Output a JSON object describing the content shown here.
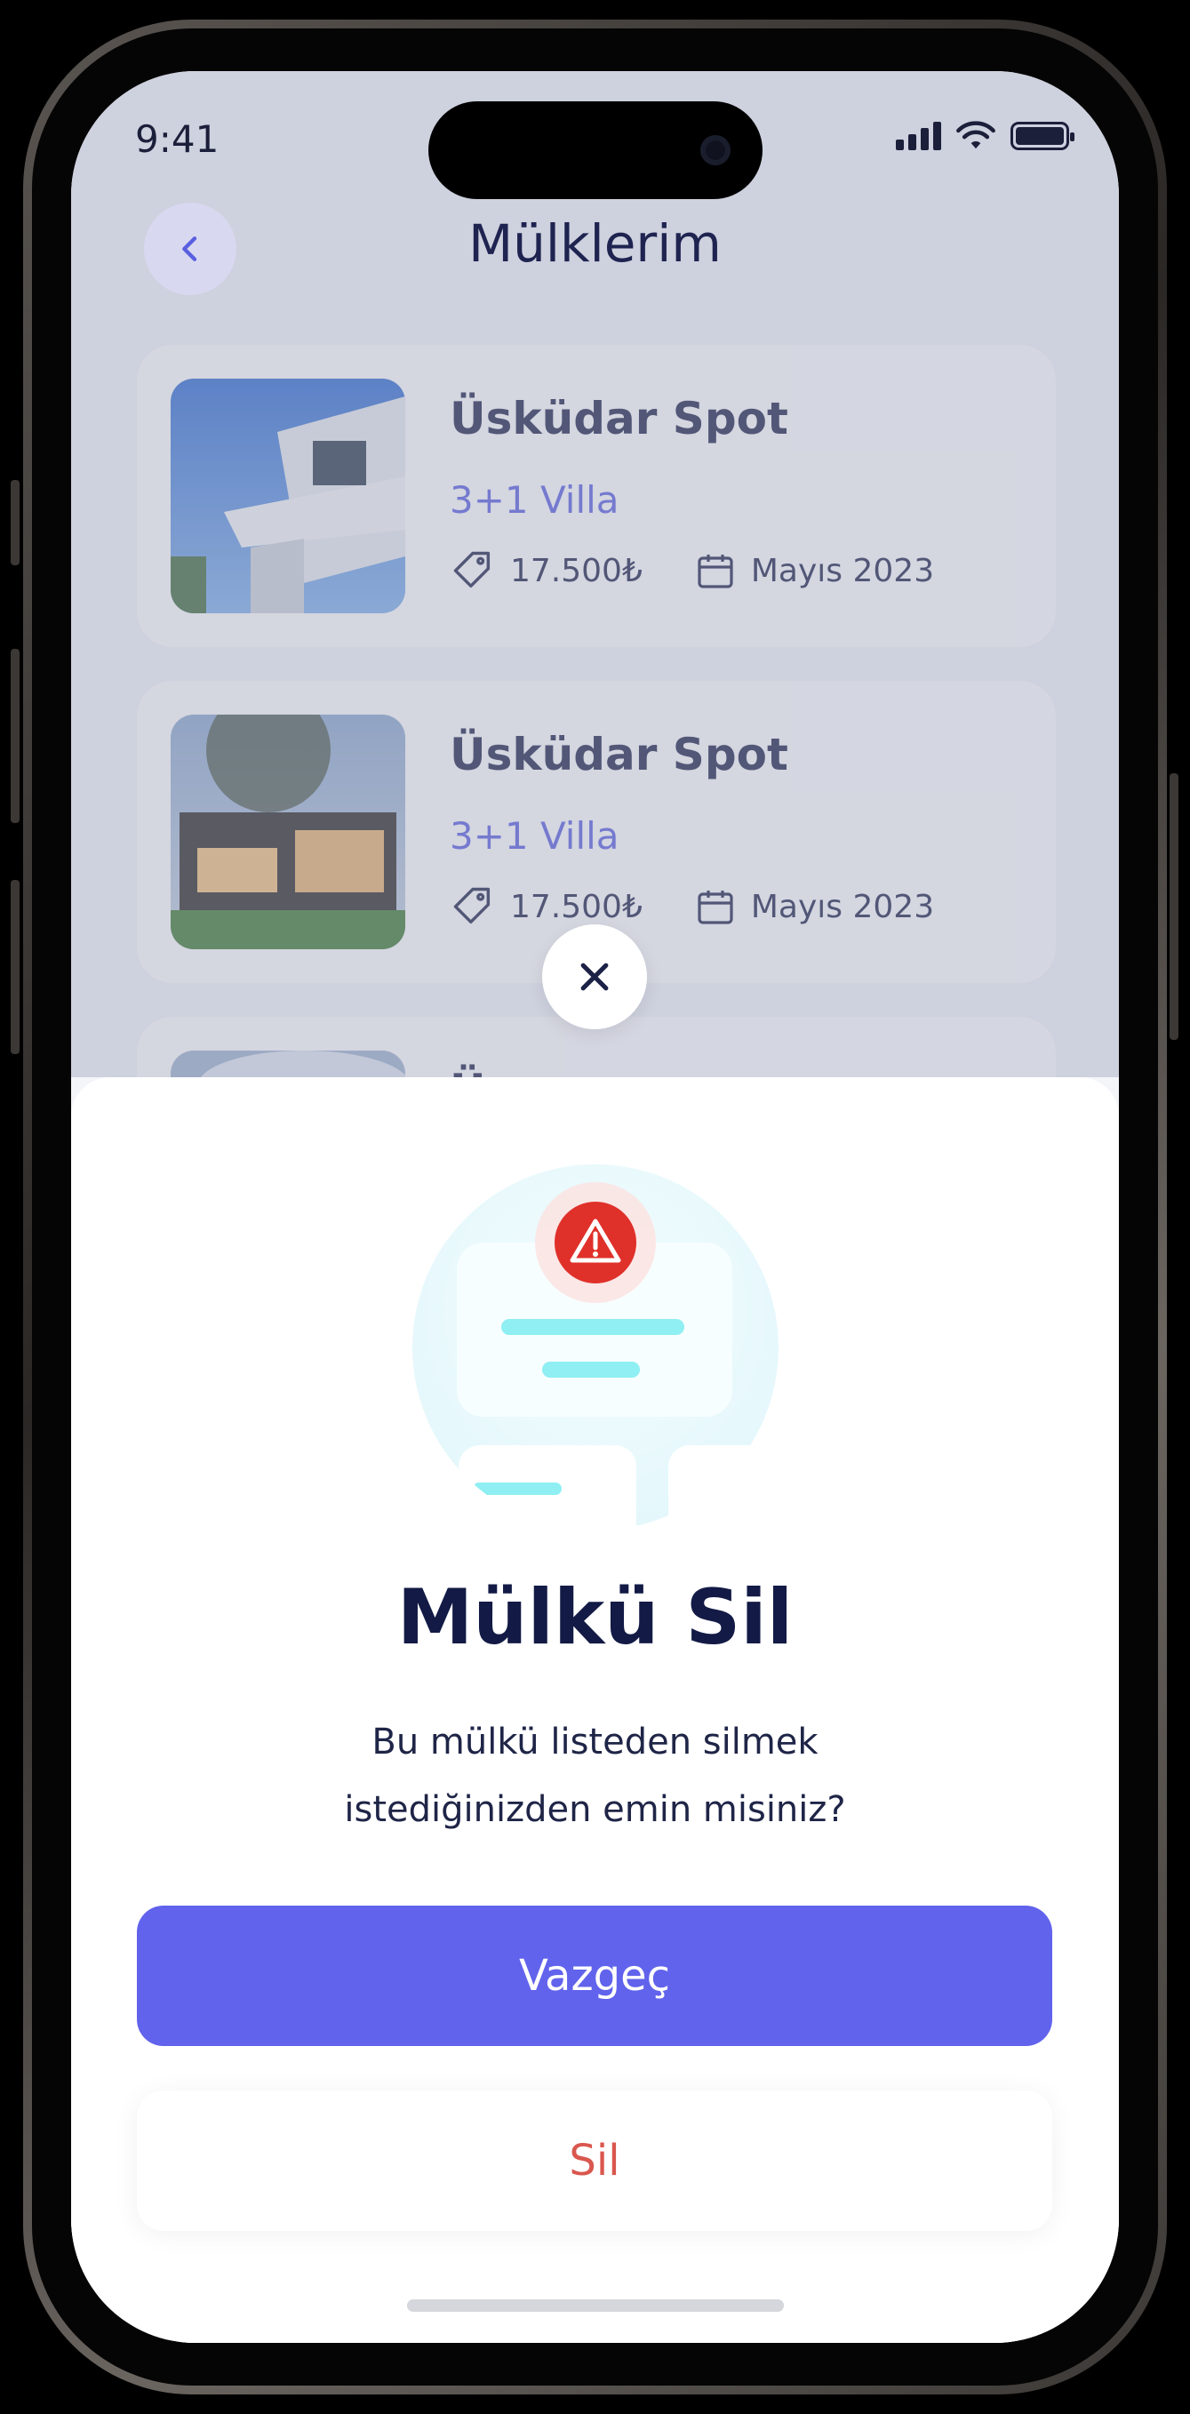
{
  "status": {
    "time": "9:41"
  },
  "header": {
    "title": "Mülklerim"
  },
  "properties": [
    {
      "name": "Üsküdar Spot",
      "type": "3+1 Villa",
      "price": "17.500₺",
      "date": "Mayıs 2023"
    },
    {
      "name": "Üsküdar Spot",
      "type": "3+1 Villa",
      "price": "17.500₺",
      "date": "Mayıs 2023"
    },
    {
      "name": "Ü"
    }
  ],
  "dialog": {
    "title": "Mülkü Sil",
    "message_line1": "Bu mülkü listeden silmek",
    "message_line2": "istediğinizden emin misiniz?",
    "cancel_label": "Vazgeç",
    "delete_label": "Sil"
  },
  "colors": {
    "accent": "#6163EC",
    "danger": "#D9574E",
    "title": "#121A45",
    "warning": "#E0302A",
    "illus_line": "#8FEFF3"
  },
  "icons": [
    "chevron-left-icon",
    "tag-icon",
    "calendar-icon",
    "close-icon",
    "warning-icon",
    "signal-icon",
    "wifi-icon",
    "battery-icon"
  ]
}
